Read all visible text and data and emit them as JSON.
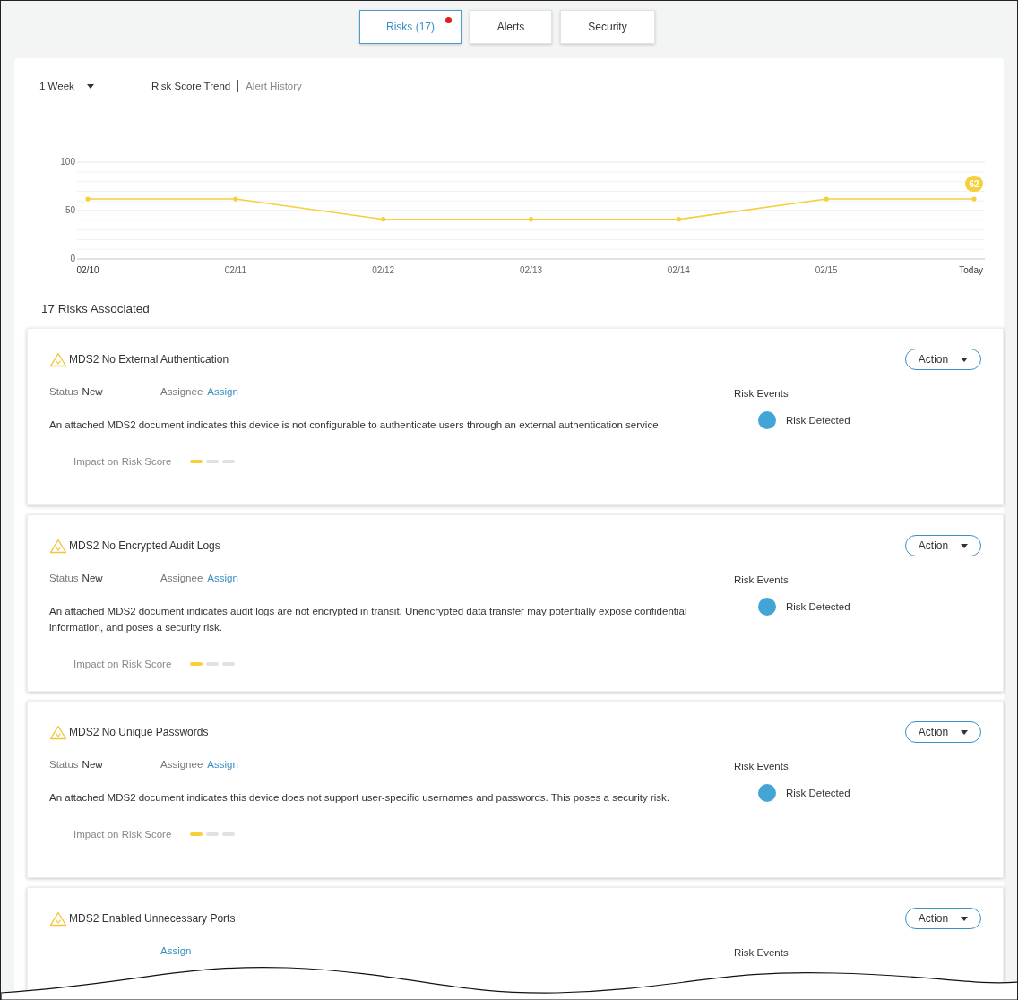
{
  "tabs": [
    {
      "label": "Risks (17)",
      "selected": true,
      "notification": true
    },
    {
      "label": "Alerts",
      "selected": false,
      "notification": false
    },
    {
      "label": "Security",
      "selected": false,
      "notification": false
    }
  ],
  "period_dropdown": {
    "value": "1 Week"
  },
  "views": [
    {
      "label": "Risk Score Trend",
      "selected": true
    },
    {
      "label": "Alert History",
      "selected": false
    }
  ],
  "chart_data": {
    "type": "line",
    "categories": [
      "02/10",
      "02/11",
      "02/12",
      "02/13",
      "02/14",
      "02/15",
      "Today"
    ],
    "series": [
      {
        "color": "#f5cf3c",
        "values": [
          62,
          62,
          41,
          41,
          41,
          62,
          62
        ]
      }
    ],
    "ylim": [
      0,
      100
    ],
    "yticks": [
      0,
      50,
      100
    ],
    "annotations": [
      {
        "x": "Today",
        "y": 62,
        "text": "62"
      }
    ]
  },
  "risks_heading": "17 Risks Associated",
  "risks": [
    {
      "title": "MDS2 No External Authentication",
      "status_label": "Status",
      "status": "New",
      "assignee_label": "Assignee",
      "assignee": "Assign",
      "description": "An attached MDS2 document indicates this device is not configurable to authenticate users through an external authentication service",
      "impact_label": "Impact on Risk Score",
      "level": 0.33,
      "action": "Action",
      "events_label": "Risk Events",
      "event": "Risk Detected",
      "color": "#42a5d5"
    },
    {
      "title": "MDS2 No Encrypted Audit Logs",
      "status_label": "Status",
      "status": "New",
      "assignee_label": "Assignee",
      "assignee": "Assign",
      "description": "An attached MDS2 document indicates audit logs are not encrypted in transit. Unencrypted data transfer may potentially expose confidential information, and poses a security risk.",
      "impact_label": "Impact on Risk Score",
      "level": 0.33,
      "action": "Action",
      "events_label": "Risk Events",
      "event": "Risk Detected",
      "color": "#42a5d5"
    },
    {
      "title": "MDS2 No Unique Passwords",
      "status_label": "Status",
      "status": "New",
      "assignee_label": "Assignee",
      "assignee": "Assign",
      "description": "An attached MDS2 document indicates this device does not support user-specific usernames and passwords. This poses a security risk.",
      "impact_label": "Impact on Risk Score",
      "level": 0.33,
      "action": "Action",
      "events_label": "Risk Events",
      "event": "Risk Detected",
      "color": "#42a5d5"
    },
    {
      "title": "MDS2 Enabled Unnecessary Ports",
      "assignee": "Assign",
      "action": "Action",
      "events_label": "Risk Events"
    }
  ]
}
